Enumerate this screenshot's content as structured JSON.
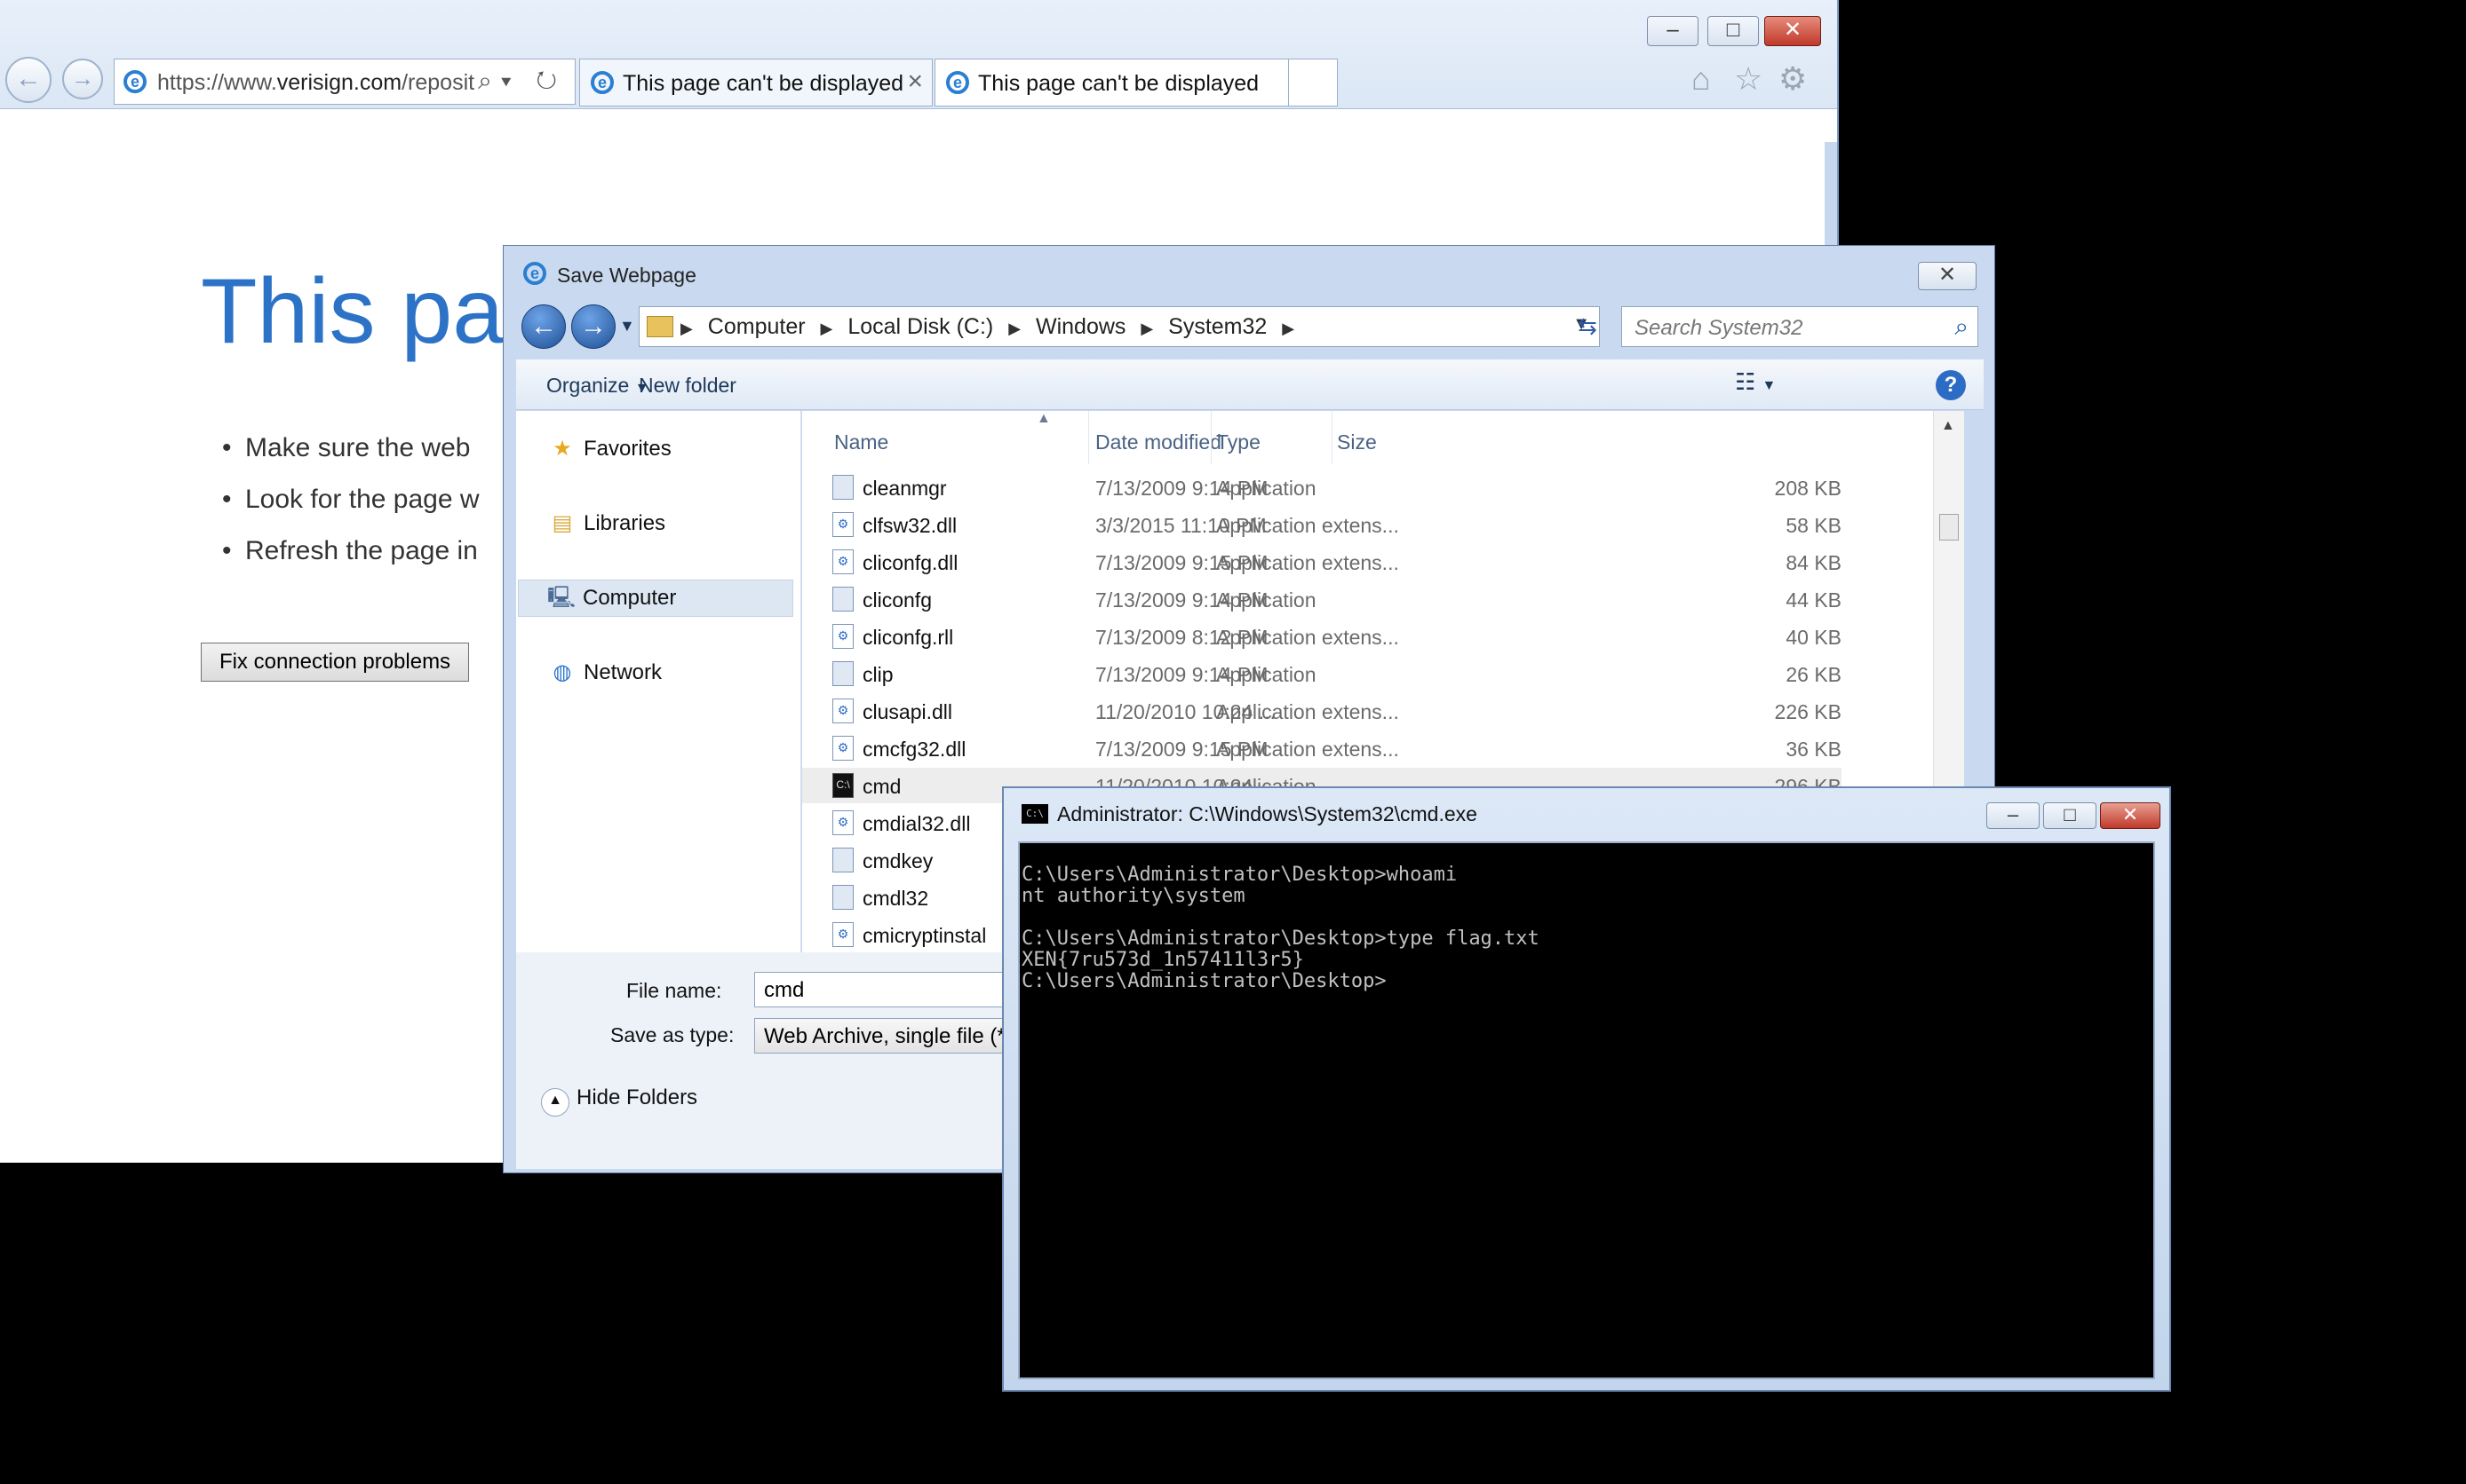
{
  "browser": {
    "address_url_host": "https://www.",
    "address_url_domain": "verisign.com",
    "address_url_rest": "/reposit",
    "address_tools": "⌕▾ ↻",
    "tabs": [
      {
        "label": "This page can't be displayed",
        "close": "×"
      },
      {
        "label": "This page can't be displayed"
      }
    ],
    "error_title": "This pag",
    "bullets": [
      "Make sure the web",
      "Look for the page w",
      "Refresh the page in"
    ],
    "fix_button": "Fix connection problems"
  },
  "dialog": {
    "title": "Save Webpage",
    "breadcrumb": [
      "Computer",
      "Local Disk (C:)",
      "Windows",
      "System32"
    ],
    "search_placeholder": "Search System32",
    "organize_label": "Organize",
    "new_folder_label": "New folder",
    "nav": {
      "favorites": "Favorites",
      "libraries": "Libraries",
      "computer": "Computer",
      "network": "Network"
    },
    "columns": {
      "name": "Name",
      "date": "Date modified",
      "type": "Type",
      "size": "Size"
    },
    "files": [
      {
        "name": "cleanmgr",
        "date": "7/13/2009 9:14 PM",
        "type": "Application",
        "size": "208 KB",
        "icon": "app-icon"
      },
      {
        "name": "clfsw32.dll",
        "date": "3/3/2015 11:10 PM",
        "type": "Application extens...",
        "size": "58 KB",
        "icon": "dll-icon"
      },
      {
        "name": "cliconfg.dll",
        "date": "7/13/2009 9:15 PM",
        "type": "Application extens...",
        "size": "84 KB",
        "icon": "dll-icon"
      },
      {
        "name": "cliconfg",
        "date": "7/13/2009 9:14 PM",
        "type": "Application",
        "size": "44 KB",
        "icon": "app-icon"
      },
      {
        "name": "cliconfg.rll",
        "date": "7/13/2009 8:12 PM",
        "type": "Application extens...",
        "size": "40 KB",
        "icon": "dll-icon"
      },
      {
        "name": "clip",
        "date": "7/13/2009 9:14 PM",
        "type": "Application",
        "size": "26 KB",
        "icon": "app-icon"
      },
      {
        "name": "clusapi.dll",
        "date": "11/20/2010 10:24 ...",
        "type": "Application extens...",
        "size": "226 KB",
        "icon": "dll-icon"
      },
      {
        "name": "cmcfg32.dll",
        "date": "7/13/2009 9:15 PM",
        "type": "Application extens...",
        "size": "36 KB",
        "icon": "dll-icon"
      },
      {
        "name": "cmd",
        "date": "11/20/2010 10:24 ...",
        "type": "Application",
        "size": "296 KB",
        "icon": "cmd-icon"
      },
      {
        "name": "cmdial32.dll",
        "date": "",
        "type": "",
        "size": "",
        "icon": "dll-icon"
      },
      {
        "name": "cmdkey",
        "date": "",
        "type": "",
        "size": "",
        "icon": "app-icon"
      },
      {
        "name": "cmdl32",
        "date": "",
        "type": "",
        "size": "",
        "icon": "app-icon"
      },
      {
        "name": "cmicryptinstal",
        "date": "",
        "type": "",
        "size": "",
        "icon": "dll-icon"
      }
    ],
    "file_name_label": "File name:",
    "file_name_value": "cmd",
    "save_type_label": "Save as type:",
    "save_type_value": "Web Archive, single file (*.m",
    "hide_folders": "Hide Folders"
  },
  "cmd": {
    "title": "Administrator: C:\\Windows\\System32\\cmd.exe",
    "lines": [
      "C:\\Users\\Administrator\\Desktop>whoami",
      "nt authority\\system",
      "",
      "C:\\Users\\Administrator\\Desktop>type flag.txt",
      "XEN{7ru573d_1n57411l3r5}",
      "C:\\Users\\Administrator\\Desktop>"
    ]
  },
  "colors": {
    "accent": "#2c72c7",
    "console_bg": "#000000",
    "console_fg": "#c0c0c0"
  }
}
